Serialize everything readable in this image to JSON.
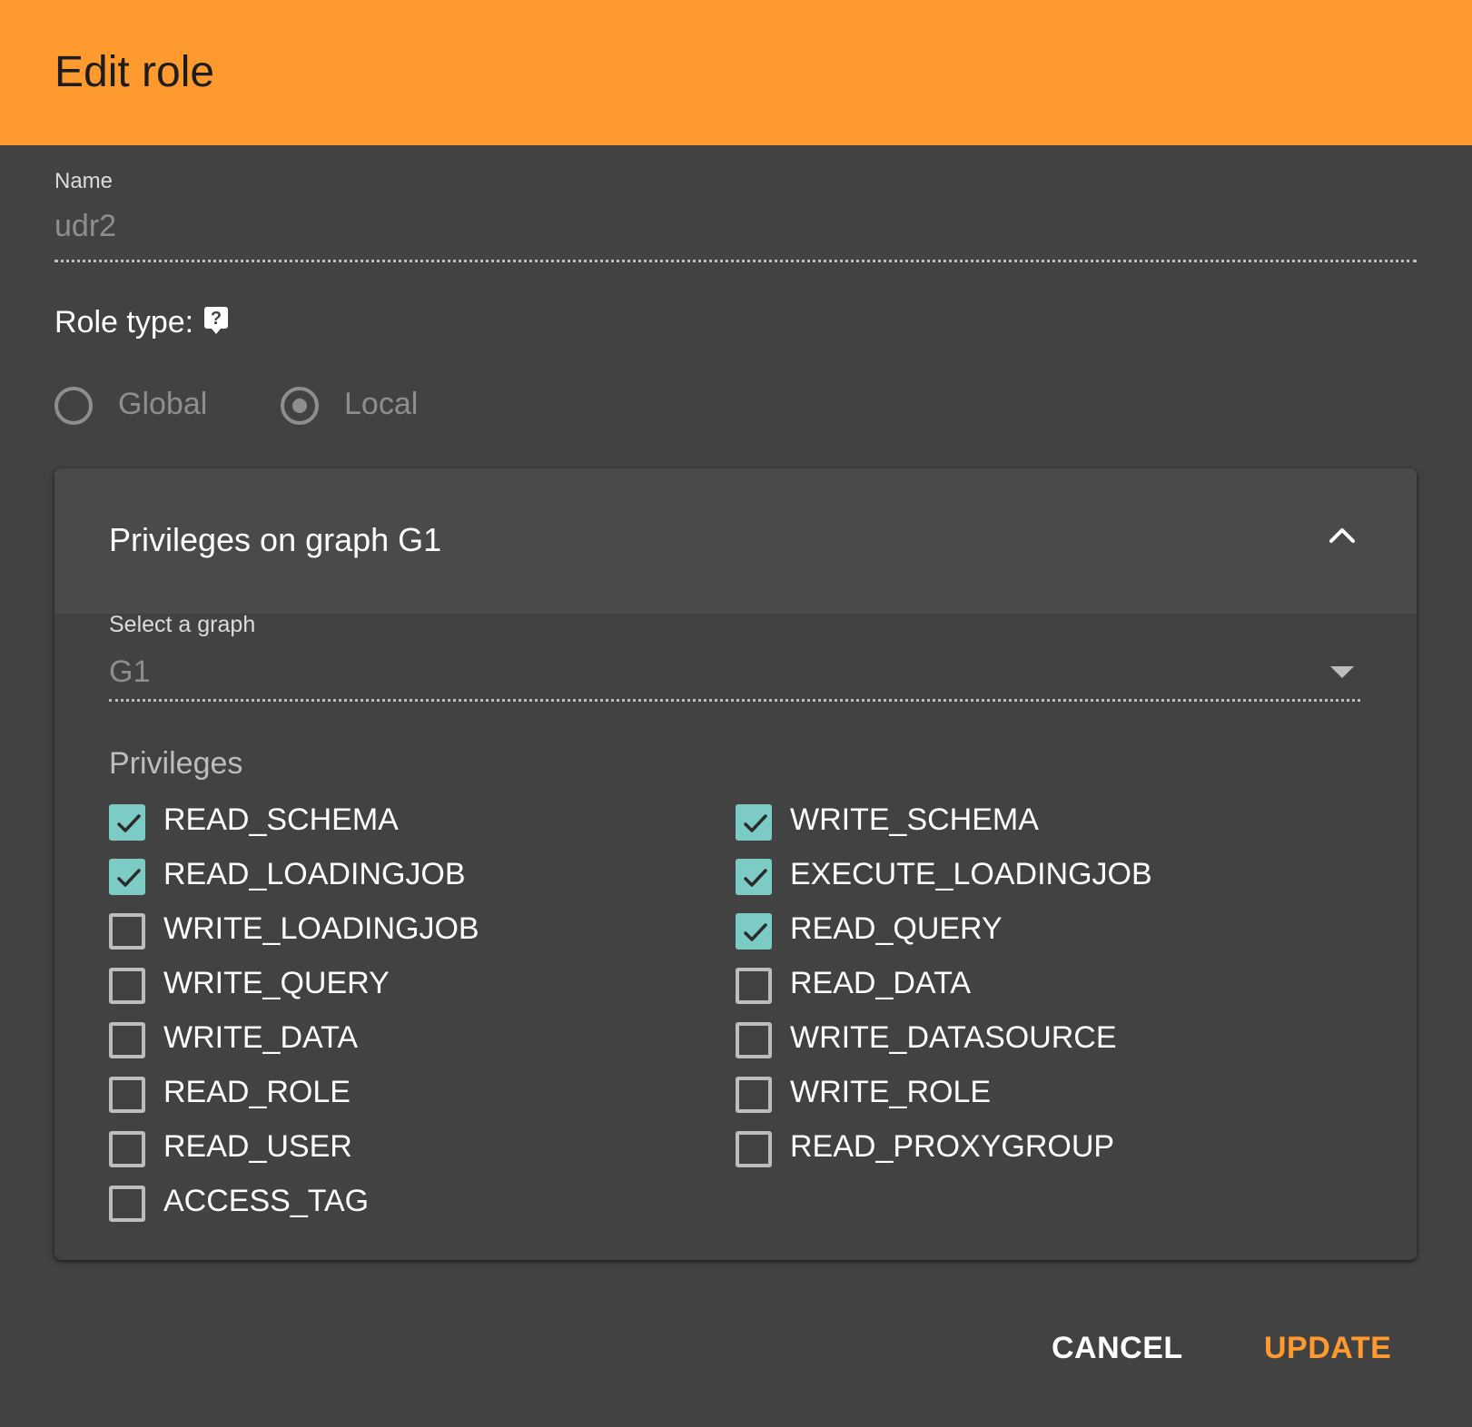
{
  "dialog": {
    "title": "Edit role"
  },
  "name_field": {
    "label": "Name",
    "value": "udr2"
  },
  "role_type": {
    "label": "Role type:",
    "options": [
      {
        "label": "Global",
        "selected": false
      },
      {
        "label": "Local",
        "selected": true
      }
    ]
  },
  "privileges_panel": {
    "title": "Privileges on graph G1",
    "select_graph": {
      "label": "Select a graph",
      "value": "G1"
    },
    "privileges_heading": "Privileges",
    "left_column": [
      {
        "label": "READ_SCHEMA",
        "checked": true
      },
      {
        "label": "READ_LOADINGJOB",
        "checked": true
      },
      {
        "label": "WRITE_LOADINGJOB",
        "checked": false
      },
      {
        "label": "WRITE_QUERY",
        "checked": false
      },
      {
        "label": "WRITE_DATA",
        "checked": false
      },
      {
        "label": "READ_ROLE",
        "checked": false
      },
      {
        "label": "READ_USER",
        "checked": false
      },
      {
        "label": "ACCESS_TAG",
        "checked": false
      }
    ],
    "right_column": [
      {
        "label": "WRITE_SCHEMA",
        "checked": true
      },
      {
        "label": "EXECUTE_LOADINGJOB",
        "checked": true
      },
      {
        "label": "READ_QUERY",
        "checked": true
      },
      {
        "label": "READ_DATA",
        "checked": false
      },
      {
        "label": "WRITE_DATASOURCE",
        "checked": false
      },
      {
        "label": "WRITE_ROLE",
        "checked": false
      },
      {
        "label": "READ_PROXYGROUP",
        "checked": false
      }
    ]
  },
  "actions": {
    "cancel_label": "CANCEL",
    "update_label": "UPDATE"
  },
  "colors": {
    "header": "#ff9a2e",
    "accent": "#ff9a2e",
    "checkbox_checked": "#7ccbc4",
    "background": "#424242"
  }
}
